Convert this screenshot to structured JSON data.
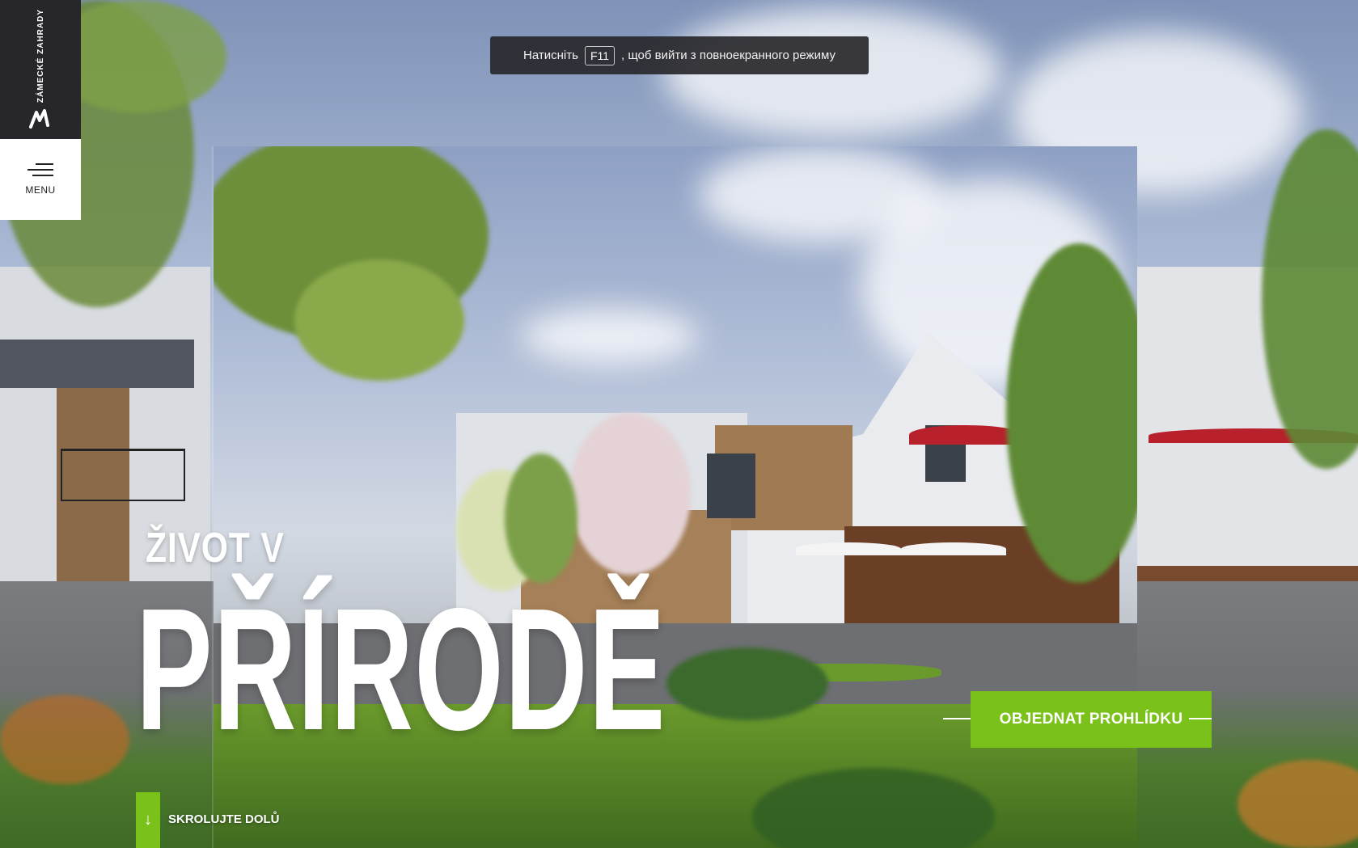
{
  "brand": {
    "logo_text": "ZÁMECKÉ ZAHRADY"
  },
  "menu": {
    "label": "MENU"
  },
  "fullscreen_notice": {
    "prefix": "Натисніть",
    "key": "F11",
    "suffix": ", щоб вийти з повноекранного режиму"
  },
  "hero": {
    "line1": "ŽIVOT V",
    "line2": "PŘÍRODĚ"
  },
  "cta": {
    "label": "OBJEDNAT PROHLÍDKU"
  },
  "scroll": {
    "label": "SKROLUJTE DOLŮ",
    "arrow": "↓"
  },
  "colors": {
    "accent": "#7ac11a",
    "dark": "#26262b"
  }
}
